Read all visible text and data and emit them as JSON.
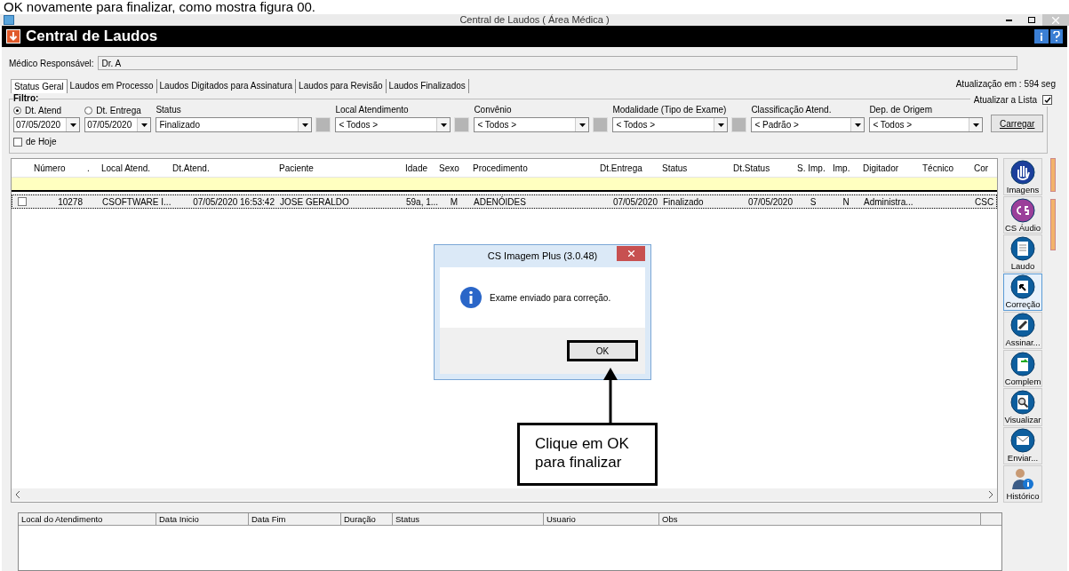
{
  "document_text": "OK novamente para finalizar, como mostra figura 00.",
  "window": {
    "title": "Central de Laudos ( Área Médica )"
  },
  "header": {
    "title": "Central de Laudos"
  },
  "medico": {
    "label": "Médico Responsável:",
    "value": "Dr. A"
  },
  "tabs": [
    {
      "label": "Status Geral",
      "selected": true
    },
    {
      "label": "Laudos em Processo",
      "selected": false
    },
    {
      "label": "Laudos Digitados para Assinatura",
      "selected": false
    },
    {
      "label": "Laudos para Revisão",
      "selected": false
    },
    {
      "label": "Laudos Finalizados",
      "selected": false
    }
  ],
  "update_text": "Atualização em : 594 seg",
  "filter": {
    "title": "Filtro:",
    "auto_update": {
      "label": "Atualizar a Lista",
      "checked": true
    },
    "radios": [
      {
        "label": "Dt. Atend",
        "selected": true,
        "value": "07/05/2020"
      },
      {
        "label": "Dt. Entrega",
        "selected": false,
        "value": "07/05/2020"
      }
    ],
    "today": {
      "label": "de Hoje",
      "checked": false
    },
    "selects": [
      {
        "label": "Status",
        "value": "Finalizado",
        "picker": true
      },
      {
        "label": "Local Atendimento",
        "value": "< Todos >",
        "picker": true
      },
      {
        "label": "Convênio",
        "value": "< Todos >",
        "picker": true
      },
      {
        "label": "Modalidade (Tipo de Exame)",
        "value": "< Todos >",
        "picker": true
      },
      {
        "label": "Classificação Atend.",
        "value": "< Padrão >",
        "picker": false
      },
      {
        "label": "Dep. de Origem",
        "value": "< Todos >",
        "picker": false
      }
    ],
    "load_button": "Carregar"
  },
  "grid": {
    "columns": [
      {
        "label": "Número"
      },
      {
        "label": "."
      },
      {
        "label": "Local Atend."
      },
      {
        "label": "Dt.Atend."
      },
      {
        "label": "Paciente"
      },
      {
        "label": "Idade"
      },
      {
        "label": "Sexo"
      },
      {
        "label": "Procedimento"
      },
      {
        "label": "Dt.Entrega"
      },
      {
        "label": "Status"
      },
      {
        "label": "Dt.Status"
      },
      {
        "label": "S. Imp."
      },
      {
        "label": "Imp."
      },
      {
        "label": "Digitador"
      },
      {
        "label": "Técnico"
      },
      {
        "label": "Cor"
      }
    ],
    "rows": [
      {
        "checked": false,
        "cells": [
          "10278",
          "",
          "CSOFTWARE I...",
          "07/05/2020 16:53:42",
          "JOSE GERALDO",
          "59a, 1...",
          "M",
          "ADENÓIDES",
          "07/05/2020",
          "Finalizado",
          "07/05/2020",
          "S",
          "N",
          "Administra...",
          "",
          "CSC"
        ]
      }
    ]
  },
  "side_buttons": [
    {
      "label": "Imagens",
      "kind": "hand",
      "selected": false
    },
    {
      "label": "CS Áudio",
      "kind": "cs",
      "selected": false
    },
    {
      "label": "Laudo",
      "kind": "doc",
      "selected": false
    },
    {
      "label": "Correção",
      "kind": "correct",
      "selected": true
    },
    {
      "label": "Assinar...",
      "kind": "sign",
      "selected": false
    },
    {
      "label": "Complem",
      "kind": "complement",
      "selected": false
    },
    {
      "label": "Visualizar",
      "kind": "view",
      "selected": false
    },
    {
      "label": "Enviar...",
      "kind": "mail",
      "selected": false
    },
    {
      "label": "Histórico",
      "kind": "person",
      "selected": false
    }
  ],
  "dialog": {
    "title": "CS Imagem Plus (3.0.48)",
    "message": "Exame enviado para correção.",
    "button": "OK"
  },
  "callout": {
    "text": "Clique em OK para finalizar"
  },
  "history": {
    "columns": [
      {
        "label": "Local do Atendimento"
      },
      {
        "label": "Data Inicio"
      },
      {
        "label": "Data Fim"
      },
      {
        "label": "Duração"
      },
      {
        "label": "Status"
      },
      {
        "label": "Usuario"
      },
      {
        "label": "Obs"
      }
    ]
  }
}
